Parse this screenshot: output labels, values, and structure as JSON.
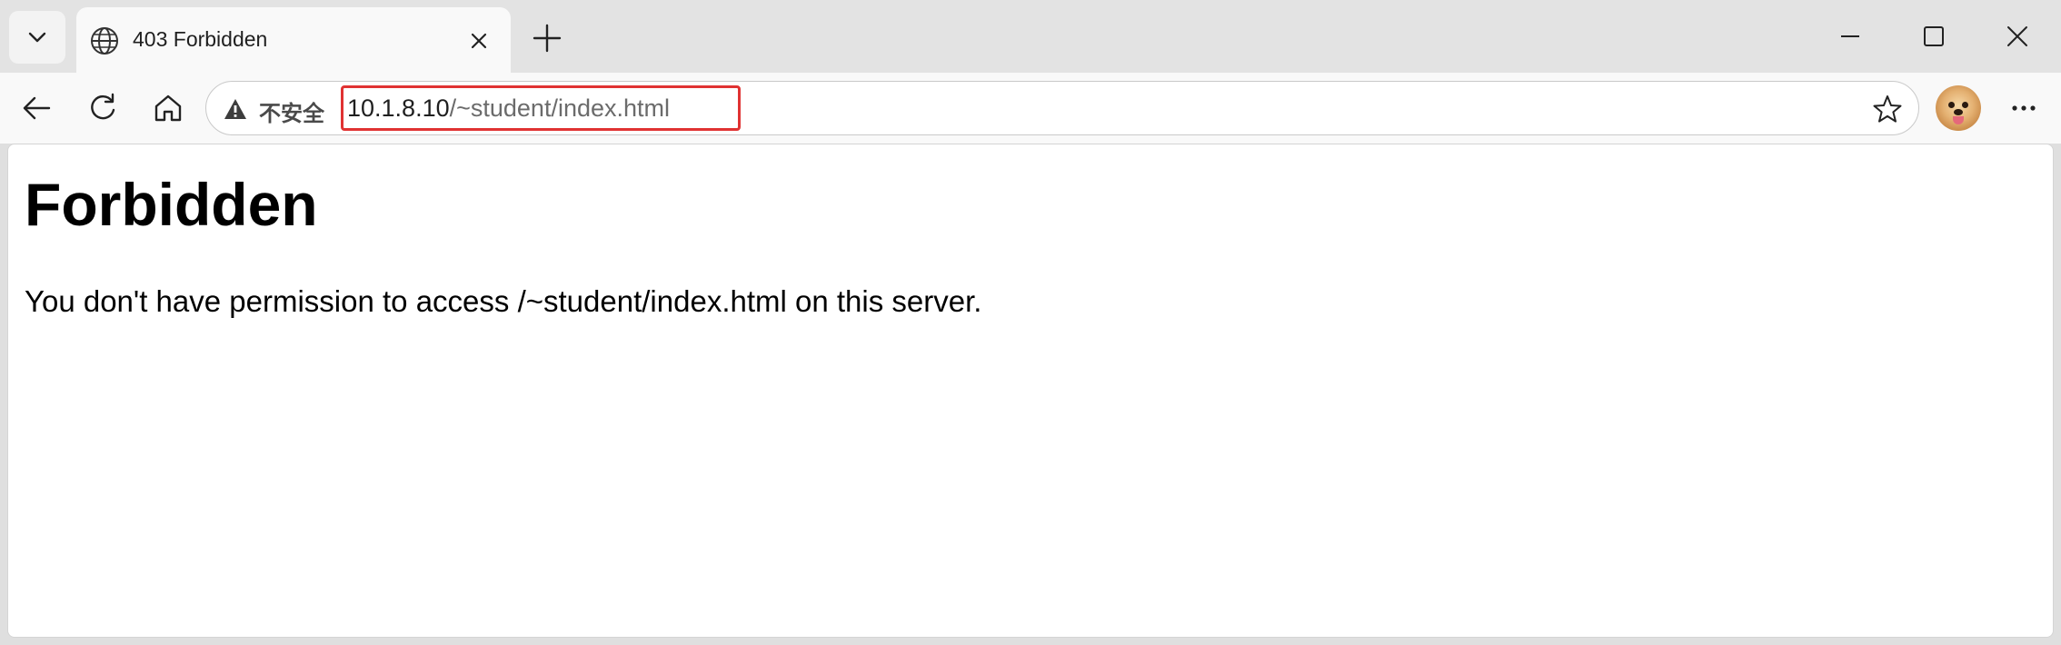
{
  "tab": {
    "title": "403 Forbidden",
    "favicon_icon": "globe-icon",
    "close_icon": "close-icon"
  },
  "tabstrip": {
    "tab_list_icon": "chevron-down-icon",
    "new_tab_icon": "plus-icon"
  },
  "window_controls": {
    "minimize_icon": "minimize-icon",
    "maximize_icon": "maximize-icon",
    "close_icon": "close-icon"
  },
  "toolbar": {
    "back_icon": "back-arrow-icon",
    "reload_icon": "reload-icon",
    "home_icon": "home-icon",
    "favorite_icon": "star-icon",
    "more_icon": "more-icon"
  },
  "address_bar": {
    "security_icon": "warning-icon",
    "security_label": "不安全",
    "url_host": "10.1.8.10",
    "url_path": "/~student/index.html",
    "highlight_color": "#e03232"
  },
  "page": {
    "heading": "Forbidden",
    "message": "You don't have permission to access /~student/index.html on this server."
  }
}
